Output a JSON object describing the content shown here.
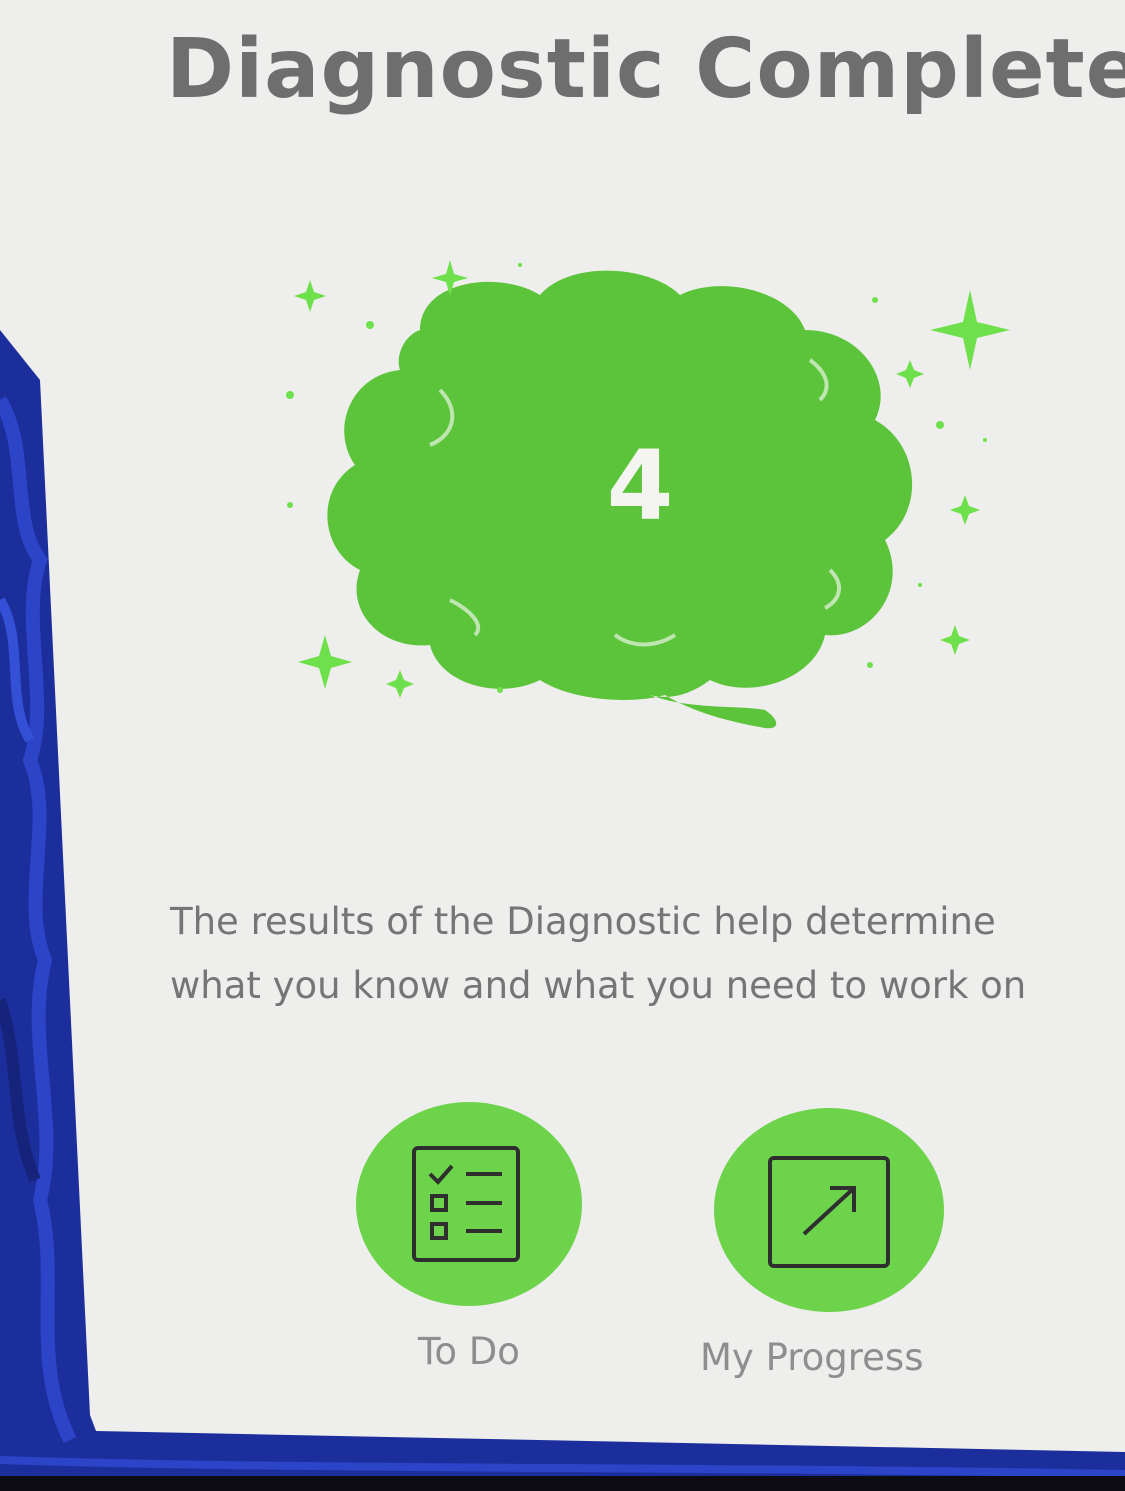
{
  "page": {
    "title": "Diagnostic Complete!"
  },
  "result": {
    "score": "4",
    "accent_color": "#5cc43a",
    "sparkle_color": "#6ee04c"
  },
  "description": {
    "line1": "The results of the Diagnostic help determine",
    "line2": "what you know and what you need to work on"
  },
  "actions": [
    {
      "label": "To Do",
      "icon": "checklist-icon"
    },
    {
      "label": "My Progress",
      "icon": "arrow-up-right-icon"
    }
  ],
  "colors": {
    "panel_bg": "#eeeeec",
    "button_green": "#6cd34a",
    "text_gray": "#757575",
    "background_blue": "#1c2e9c"
  }
}
